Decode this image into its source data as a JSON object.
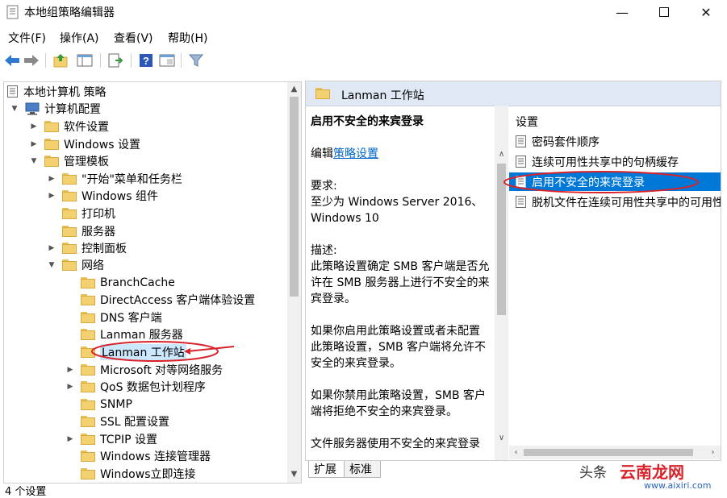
{
  "window": {
    "title": "本地组策略编辑器"
  },
  "menu": [
    "文件(F)",
    "操作(A)",
    "查看(V)",
    "帮助(H)"
  ],
  "tree": [
    {
      "label": "本地计算机 策略",
      "icon": "computer-policy-icon"
    },
    {
      "label": "计算机配置",
      "icon": "computer-icon"
    },
    {
      "label": "软件设置"
    },
    {
      "label": "Windows 设置"
    },
    {
      "label": "管理模板"
    },
    {
      "label": "\"开始\"菜单和任务栏"
    },
    {
      "label": "Windows 组件"
    },
    {
      "label": "打印机"
    },
    {
      "label": "服务器"
    },
    {
      "label": "控制面板"
    },
    {
      "label": "网络"
    },
    {
      "label": "BranchCache"
    },
    {
      "label": "DirectAccess 客户端体验设置"
    },
    {
      "label": "DNS 客户端"
    },
    {
      "label": "Lanman 服务器"
    },
    {
      "label": "Lanman 工作站"
    },
    {
      "label": "Microsoft 对等网络服务"
    },
    {
      "label": "QoS 数据包计划程序"
    },
    {
      "label": "SNMP"
    },
    {
      "label": "SSL 配置设置"
    },
    {
      "label": "TCPIP 设置"
    },
    {
      "label": "Windows 连接管理器"
    },
    {
      "label": "Windows立即连接"
    }
  ],
  "right_pane": {
    "header": "Lanman 工作站",
    "description": {
      "title": "启用不安全的来宾登录",
      "edit_prefix": "编辑",
      "edit_link": "策略设置",
      "requirements_label": "要求:",
      "requirements_text": "至少为 Windows Server 2016、Windows 10",
      "desc_label": "描述:",
      "para1": "此策略设置确定 SMB 客户端是否允许在 SMB 服务器上进行不安全的来宾登录。",
      "para2": "如果你启用此策略设置或者未配置此策略设置，SMB 客户端将允许不安全的来宾登录。",
      "para3": "如果你禁用此策略设置，SMB 客户端将拒绝不安全的来宾登录。",
      "para4": "文件服务器使用不安全的来宾登录"
    },
    "settings_header": "设置",
    "settings": [
      "密码套件顺序",
      "连续可用性共享中的句柄缓存",
      "启用不安全的来宾登录",
      "脱机文件在连续可用性共享中的可用性"
    ]
  },
  "tabs": [
    "扩展",
    "标准"
  ],
  "status": "4 个设置",
  "watermark": {
    "brand": "头条",
    "site": "云南龙网",
    "url": "www.aixiri.com"
  },
  "colors": {
    "selection": "#0078d7",
    "header_bg": "#dfe8f3",
    "annotation": "#d8232a",
    "link": "#0066cc"
  }
}
